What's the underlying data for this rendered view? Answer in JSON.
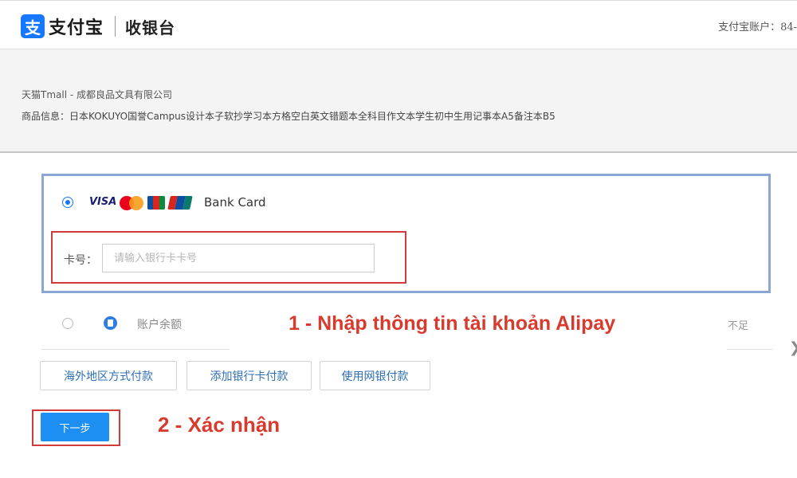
{
  "header": {
    "logo_glyph": "支",
    "brand_name": "支付宝",
    "section_title": "收银台",
    "account_text": "支付宝账户：84-"
  },
  "order": {
    "merchant": "天猫Tmall - 成都良品文具有限公司",
    "goods_info": "商品信息：日本KOKUYO国誉Campus设计本子软抄学习本方格空白英文错题本全科目作文本学生初中生用记事本A5备注本B5"
  },
  "payment": {
    "card_brands": [
      "VISA",
      "JCB"
    ],
    "bank_card_label": "Bank Card",
    "card_number_label": "卡号：",
    "card_number_placeholder": "请输入银行卡卡号",
    "card_number_value": "",
    "balance_label": "账户余额",
    "balance_status": "不足",
    "options": [
      "海外地区方式付款",
      "添加银行卡付款",
      "使用网银付款"
    ],
    "next_button": "下一步"
  },
  "annotations": {
    "step1": "1 - Nhập thông tin tài khoản Alipay",
    "step2": "2 - Xác nhận"
  },
  "colors": {
    "accent": "#1677ff",
    "annotation_red": "#d83a2e",
    "selection_border": "#8aa6d4",
    "next_button": "#1e8ff2"
  },
  "icons": {
    "logo": "alipay-logo-icon",
    "mastercard": "mastercard-icon",
    "unionpay": "unionpay-icon",
    "balance": "wallet-balance-icon",
    "scroll_right": "chevron-right-icon"
  }
}
